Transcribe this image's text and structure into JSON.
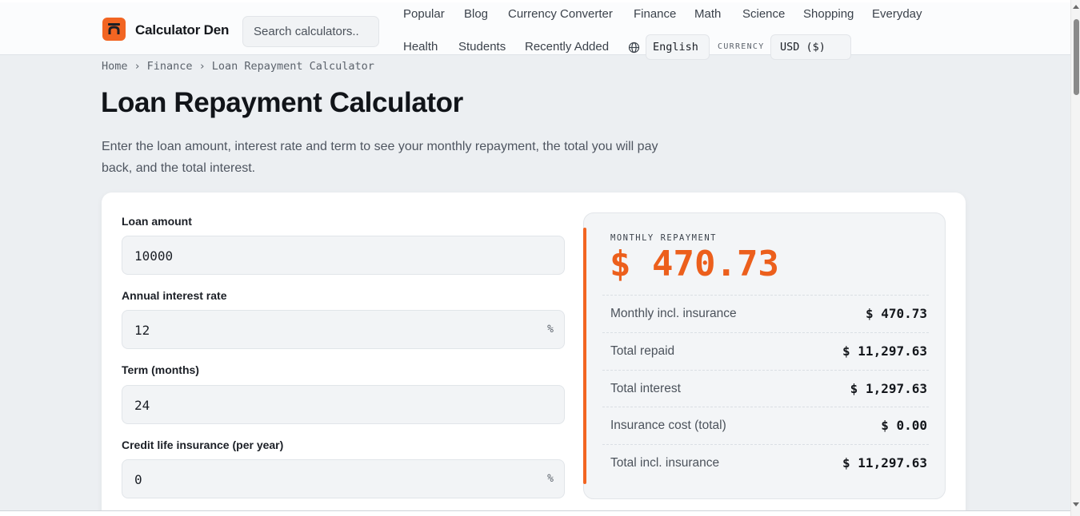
{
  "header": {
    "brand": "Calculator Den",
    "search_placeholder": "Search calculators..",
    "nav_row1": [
      "Popular",
      "Blog",
      "Currency Converter",
      "Finance",
      "Math",
      "Science",
      "Shopping",
      "Everyday"
    ],
    "nav_row2": [
      "Health",
      "Students",
      "Recently Added"
    ],
    "language": "English",
    "currency_label": "CURRENCY",
    "currency": "USD ($)"
  },
  "breadcrumb": [
    "Home",
    "Finance",
    "Loan Repayment Calculator"
  ],
  "page": {
    "title": "Loan Repayment Calculator",
    "lead": "Enter the loan amount, interest rate and term to see your monthly repayment, the total you will pay back, and the total interest."
  },
  "form": {
    "loan_amount": {
      "label": "Loan amount",
      "value": "10000"
    },
    "interest_rate": {
      "label": "Annual interest rate",
      "value": "12",
      "suffix": "%"
    },
    "term": {
      "label": "Term (months)",
      "value": "24"
    },
    "insurance": {
      "label": "Credit life insurance (per year)",
      "value": "0",
      "suffix": "%"
    }
  },
  "results": {
    "headline_label": "MONTHLY REPAYMENT",
    "headline_value": "$ 470.73",
    "rows": [
      {
        "label": "Monthly incl. insurance",
        "value": "$ 470.73"
      },
      {
        "label": "Total repaid",
        "value": "$ 11,297.63"
      },
      {
        "label": "Total interest",
        "value": "$ 1,297.63"
      },
      {
        "label": "Insurance cost (total)",
        "value": "$ 0.00"
      },
      {
        "label": "Total incl. insurance",
        "value": "$ 11,297.63"
      }
    ]
  },
  "colors": {
    "accent": "#f26522",
    "background": "#eceff2",
    "card": "#ffffff"
  },
  "icons": [
    "calculator-den-logo-icon",
    "globe-icon"
  ]
}
